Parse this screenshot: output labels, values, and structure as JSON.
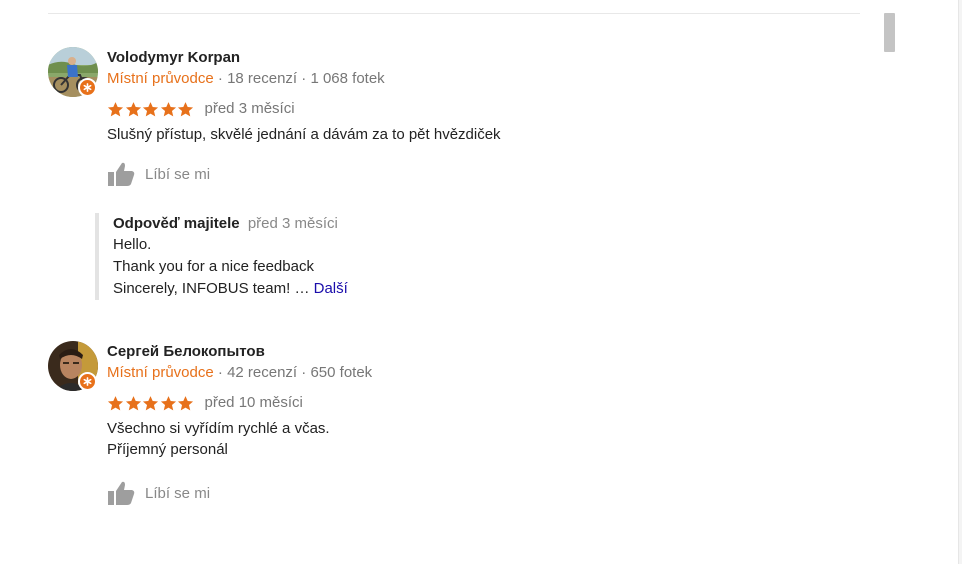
{
  "reviews": [
    {
      "author": "Volodymyr Korpan",
      "guide_label": "Místní průvodce",
      "separator": "·",
      "reviews_count": "18 recenzí",
      "photos_count": "1 068 fotek",
      "rating": 5,
      "date": "před 3 měsíci",
      "text_lines": [
        "Slušný přístup, skvělé jednání a dávám za to pět hvězdiček"
      ],
      "like_label": "Líbí se mi",
      "owner_reply": {
        "title": "Odpověď majitele",
        "date": "před 3 měsíci",
        "lines": [
          "Hello.",
          "Thank you for a nice feedback",
          "Sincerely, INFOBUS team!"
        ],
        "ellipsis": "…",
        "more_label": "Další"
      }
    },
    {
      "author": "Сергей Белокопытов",
      "guide_label": "Místní průvodce",
      "separator": "·",
      "reviews_count": "42 recenzí",
      "photos_count": "650 fotek",
      "rating": 5,
      "date": "před 10 měsíci",
      "text_lines": [
        "Všechno si vyřídím rychlé a včas.",
        "Příjemný personál"
      ],
      "like_label": "Líbí se mi"
    }
  ],
  "colors": {
    "guide": "#e7711b",
    "star": "#e7711b",
    "link": "#1a0dab",
    "muted": "#777777"
  }
}
